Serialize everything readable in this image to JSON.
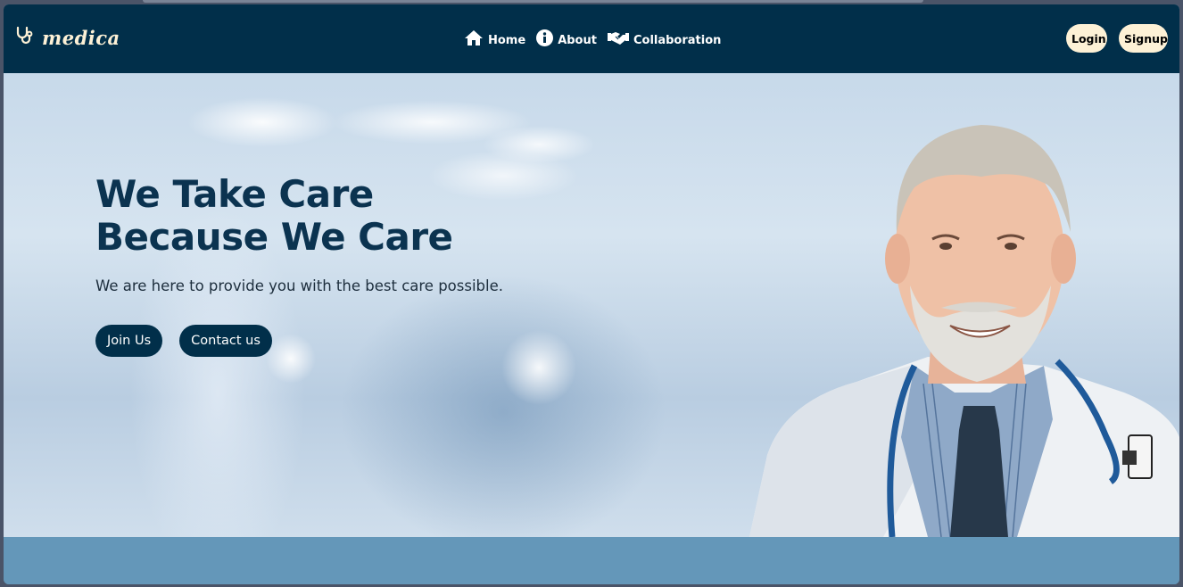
{
  "brand": {
    "name": "medica",
    "logo_icon": "stethoscope-icon"
  },
  "nav": {
    "links": [
      {
        "label": "Home",
        "icon": "home-icon"
      },
      {
        "label": "About",
        "icon": "info-icon"
      },
      {
        "label": "Collaboration",
        "icon": "handshake-icon"
      }
    ]
  },
  "auth": {
    "login_label": "Login",
    "signup_label": "Signup"
  },
  "hero": {
    "title_line1": "We Take Care",
    "title_line2": "Because We Care",
    "subtitle": "We are here to provide you with the best care possible.",
    "join_label": "Join Us",
    "contact_label": "Contact us",
    "image": "doctor-photo"
  },
  "colors": {
    "navbar": "#012f4a",
    "accent_cream": "#fdf1d6",
    "title": "#0b3350",
    "footer_band": "#6497b9"
  }
}
